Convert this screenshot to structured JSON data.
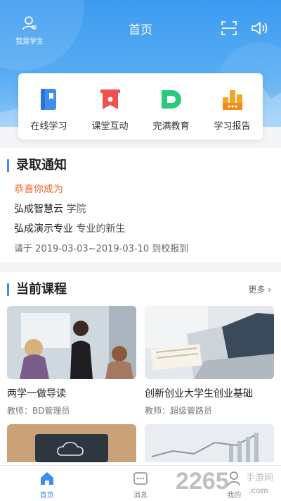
{
  "header": {
    "title": "首页",
    "user_label": "我是学生",
    "colors": {
      "primary": "#3d9bf0",
      "accent_orange": "#f26a30"
    }
  },
  "quick_menu": [
    {
      "label": "在线学习",
      "icon": "book-icon"
    },
    {
      "label": "课堂互动",
      "icon": "banner-icon"
    },
    {
      "label": "完满教育",
      "icon": "d-logo-icon"
    },
    {
      "label": "学习报告",
      "icon": "bar-chart-icon"
    }
  ],
  "notice": {
    "title": "录取通知",
    "congrats": "恭喜你成为",
    "college_name": "弘成智慧云",
    "college_suffix": "学院",
    "major_name": "弘成演示专业",
    "major_suffix": "专业的新生",
    "report_prefix": "请于",
    "report_range": "2019-03-03~2019-03-10",
    "report_suffix": "到校报到"
  },
  "courses": {
    "title": "当前课程",
    "more_label": "更多",
    "items": [
      {
        "name": "两学一做导读",
        "teacher": "教师：BD管理员"
      },
      {
        "name": "创新创业大学生创业基础",
        "teacher": "教师：超级管路员"
      },
      {
        "name": "",
        "teacher": ""
      },
      {
        "name": "",
        "teacher": ""
      }
    ]
  },
  "tabbar": [
    {
      "label": "首页",
      "icon": "home-icon",
      "active": true
    },
    {
      "label": "消息",
      "icon": "message-icon",
      "active": false
    },
    {
      "label": "我的",
      "icon": "profile-icon",
      "active": false
    }
  ],
  "watermark": {
    "number": "2265",
    "site": "手游网",
    "domain": ".com"
  }
}
